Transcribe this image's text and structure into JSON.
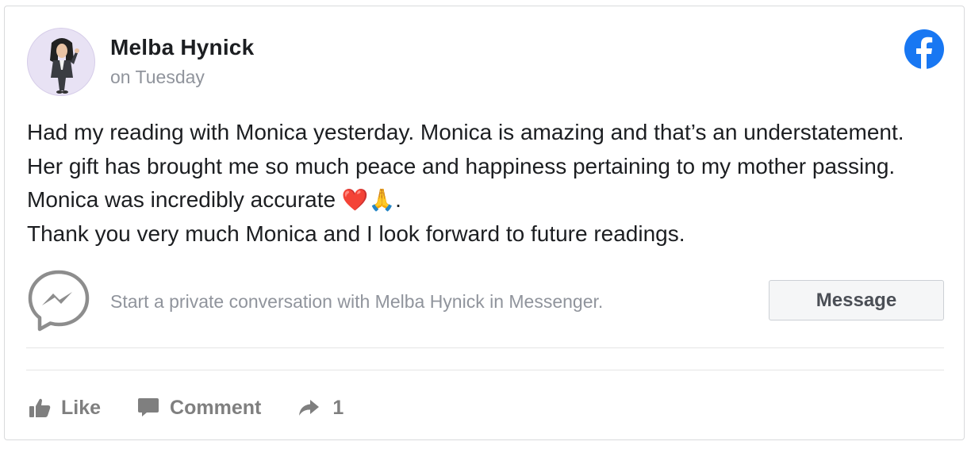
{
  "post": {
    "author_name": "Melba Hynick",
    "timestamp": "on Tuesday",
    "body_lines": [
      "Had my reading with Monica yesterday. Monica is amazing and that’s an understatement. Her gift has brought me so much peace and happiness pertaining to my mother passing. Monica was incredibly accurate ",
      "Thank you very much Monica and I look forward to future readings."
    ],
    "body_emojis": "❤️🙏",
    "body_end": "."
  },
  "messenger": {
    "prompt": "Start a private conversation with Melba Hynick in Messenger.",
    "button_label": "Message"
  },
  "actions": {
    "like_label": "Like",
    "comment_label": "Comment",
    "share_count": "1"
  },
  "icons": {
    "logo": "facebook-logo-icon",
    "messenger": "messenger-icon",
    "like": "thumbs-up-icon",
    "comment": "comment-bubble-icon",
    "share": "share-arrow-icon"
  },
  "colors": {
    "facebook_blue": "#1877f2",
    "text_primary": "#1c1e21",
    "text_secondary": "#90949c",
    "action_gray": "#7f7f7f",
    "messenger_gray": "#8d8d8d"
  }
}
